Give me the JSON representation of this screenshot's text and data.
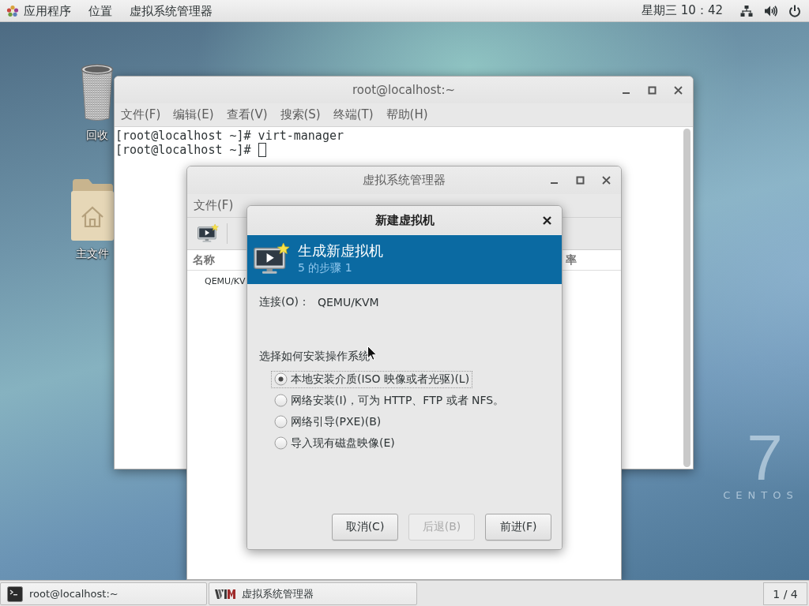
{
  "top_bar": {
    "menus": [
      "应用程序",
      "位置",
      "虚拟系统管理器"
    ],
    "clock": "星期三 10：42"
  },
  "desktop_icons": [
    {
      "kind": "trash",
      "label": "回收"
    },
    {
      "kind": "home-folder",
      "label": "主文件"
    }
  ],
  "terminal_window": {
    "title": "root@localhost:~",
    "menu": [
      "文件(F)",
      "编辑(E)",
      "查看(V)",
      "搜索(S)",
      "终端(T)",
      "帮助(H)"
    ],
    "lines": [
      {
        "text": "[root@localhost ~]# virt-manager",
        "cursor": false
      },
      {
        "text": "[root@localhost ~]#",
        "cursor": true
      }
    ]
  },
  "manager_window": {
    "title": "虚拟系统管理器",
    "menu": [
      "文件(F)"
    ],
    "columns": [
      "名称",
      "率"
    ],
    "rows": [
      "QEMU/KV"
    ]
  },
  "dialog": {
    "title": "新建虚拟机",
    "header": {
      "title": "生成新虚拟机",
      "subtitle": "5 的步骤 1"
    },
    "connection": {
      "label": "连接(O)：",
      "value": "QEMU/KVM"
    },
    "prompt": "选择如何安装操作系统",
    "options": [
      {
        "label": "本地安装介质(ISO 映像或者光驱)(L)",
        "selected": true
      },
      {
        "label": "网络安装(I)，可为 HTTP、FTP 或者 NFS。",
        "selected": false
      },
      {
        "label": "网络引导(PXE)(B)",
        "selected": false
      },
      {
        "label": "导入现有磁盘映像(E)",
        "selected": false
      }
    ],
    "buttons": [
      {
        "label": "取消(C)",
        "disabled": false
      },
      {
        "label": "后退(B)",
        "disabled": true
      },
      {
        "label": "前进(F)",
        "disabled": false
      }
    ]
  },
  "taskbar": {
    "tasks": [
      {
        "kind": "terminal",
        "label": "root@localhost:~"
      },
      {
        "kind": "virt-manager",
        "label": "虚拟系统管理器"
      }
    ],
    "workspace": "1 / 4"
  },
  "wallpaper_logo": {
    "numeral": "7",
    "wordmark": "CENTOS"
  }
}
